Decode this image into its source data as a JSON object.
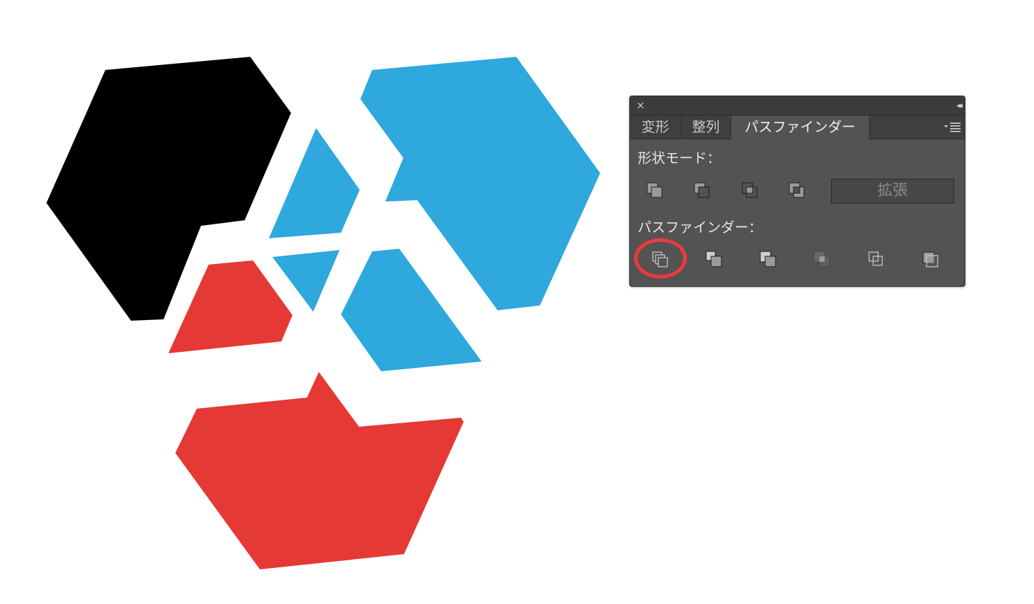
{
  "artwork": {
    "colors": {
      "black": "#000000",
      "blue": "#2ea8dd",
      "red": "#e53935"
    }
  },
  "panel": {
    "close_icon": "×",
    "collapse_icon": "◂◂",
    "tabs": [
      {
        "label": "変形",
        "active": false
      },
      {
        "label": "整列",
        "active": false
      },
      {
        "label": "パスファインダー",
        "active": true
      }
    ],
    "menu_icon": "panel-menu-icon",
    "shape_modes": {
      "label": "形状モード：",
      "buttons": [
        "unite-icon",
        "minus-front-icon",
        "intersect-icon",
        "exclude-icon"
      ],
      "expand_label": "拡張"
    },
    "pathfinders": {
      "label": "パスファインダー：",
      "buttons": [
        "divide-icon",
        "trim-icon",
        "merge-icon",
        "crop-icon",
        "outline-icon",
        "minus-back-icon"
      ],
      "highlighted": "divide-icon",
      "highlight_color": "#f0393c"
    }
  }
}
